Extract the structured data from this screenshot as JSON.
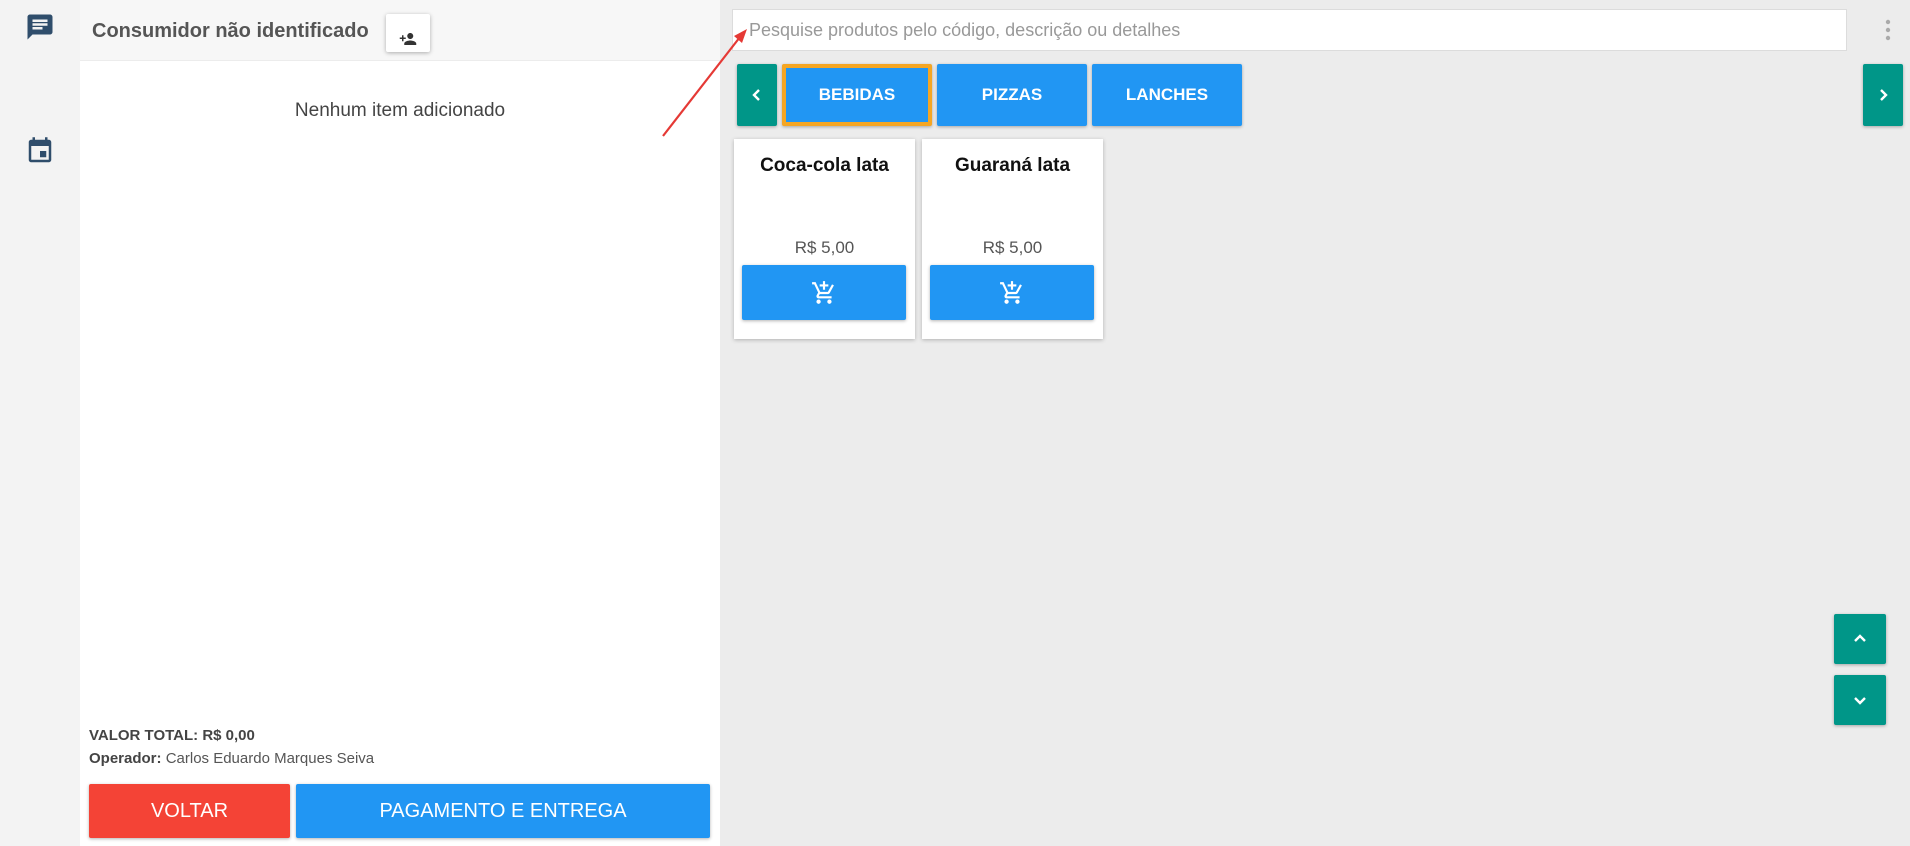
{
  "sidebar": {
    "icons": [
      {
        "name": "chat-icon",
        "color": "#2f4d6b"
      },
      {
        "name": "calendar-icon",
        "color": "#2f4d6b"
      }
    ]
  },
  "order": {
    "consumer_name": "Consumidor não identificado",
    "add_consumer_icon": "add-person-icon",
    "empty_message": "Nenhum item adicionado",
    "total_label": "VALOR TOTAL:",
    "total_value": "R$ 0,00",
    "operator_label": "Operador:",
    "operator_name": "Carlos Eduardo Marques Seiva",
    "back_label": "VOLTAR",
    "payment_label": "PAGAMENTO E ENTREGA"
  },
  "search": {
    "value": "",
    "placeholder": "Pesquise produtos pelo código, descrição ou detalhes"
  },
  "categories": {
    "tabs": [
      {
        "label": "BEBIDAS",
        "active": true
      },
      {
        "label": "PIZZAS",
        "active": false
      },
      {
        "label": "LANCHES",
        "active": false
      }
    ]
  },
  "products": [
    {
      "name": "Coca-cola lata",
      "price": "R$ 5,00"
    },
    {
      "name": "Guaraná lata",
      "price": "R$ 5,00"
    }
  ],
  "colors": {
    "primary": "#2196f3",
    "accent": "#009688",
    "danger": "#f44336",
    "highlight": "#f5a623",
    "annotation": "#e53935"
  }
}
